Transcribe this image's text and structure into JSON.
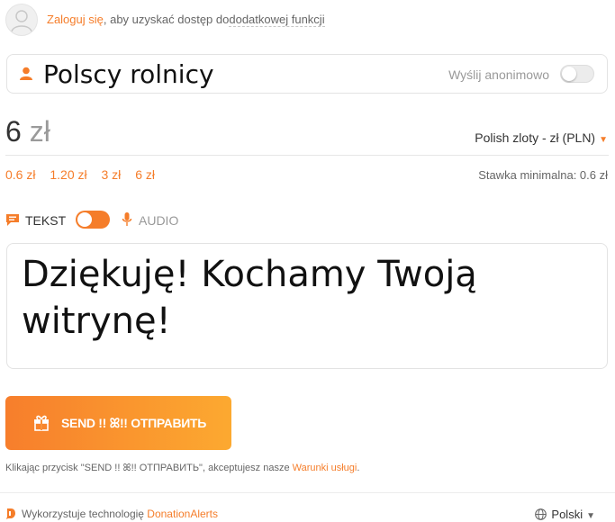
{
  "login": {
    "link": "Zaloguj się",
    "middle": ", aby uzyskać dostęp do",
    "rest": "dodatkowej funkcji"
  },
  "name_field": {
    "value": "Polscy rolnicy",
    "anon_label": "Wyślij anonimowo",
    "anon_enabled": false
  },
  "amount": {
    "value": "6",
    "unit": "zł",
    "currency": "Polish zloty - zł (PLN)",
    "presets": [
      "0.6 zł",
      "1.20 zł",
      "3 zł",
      "6 zł"
    ],
    "min_rate": "Stawka minimalna: 0.6 zł"
  },
  "mode": {
    "text_label": "TEKST",
    "audio_label": "AUDIO",
    "toggle_on": true
  },
  "message": {
    "text": "Dziękuję! Kochamy Twoją witrynę!"
  },
  "send": {
    "label": "SEND !! ꕤ!! ОТПРАВИТЬ"
  },
  "terms": {
    "prefix": "Klikając przycisk \"SEND !! ꕤ!! ОТПРАВИТЬ\", akceptujesz nasze ",
    "link": "Warunki usługi",
    "suffix": "."
  },
  "footer": {
    "prefix": "Wykorzystuje technologię ",
    "link": "DonationAlerts",
    "language": "Polski"
  },
  "colors": {
    "accent": "#f57d2a",
    "gradient_end": "#fca930"
  }
}
